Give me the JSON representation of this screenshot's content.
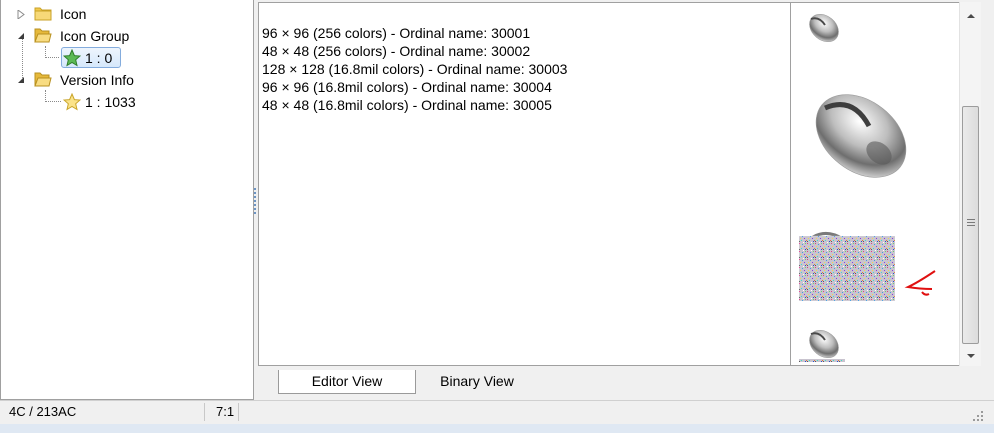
{
  "tree": {
    "nodes": [
      {
        "label": "Icon"
      },
      {
        "label": "Icon Group"
      },
      {
        "label": "1 : 0"
      },
      {
        "label": "Version Info"
      },
      {
        "label": "1 : 1033"
      }
    ]
  },
  "editor": {
    "entries": [
      "96 × 96 (256 colors) - Ordinal name: 30001",
      "48 × 48 (256 colors) - Ordinal name: 30002",
      "128 × 128 (16.8mil colors) - Ordinal name: 30003",
      "96 × 96 (16.8mil colors) - Ordinal name: 30004",
      "48 × 48 (16.8mil colors) - Ordinal name: 30005"
    ]
  },
  "tabs": [
    {
      "label": "Editor View",
      "active": true
    },
    {
      "label": "Binary View",
      "active": false
    }
  ],
  "status": {
    "offset": "4C / 213AC",
    "position": "7:1"
  },
  "colors": {
    "annotation": "#e01010",
    "selection": "#d6e8fb",
    "folder": "#f0c040",
    "star": "#f5d24a",
    "star_selected": "#4fb04a"
  },
  "icons": {
    "folder": "folder-icon",
    "folder_open": "folder-open-icon",
    "star": "star-icon",
    "arrow": "annotation-arrow"
  }
}
